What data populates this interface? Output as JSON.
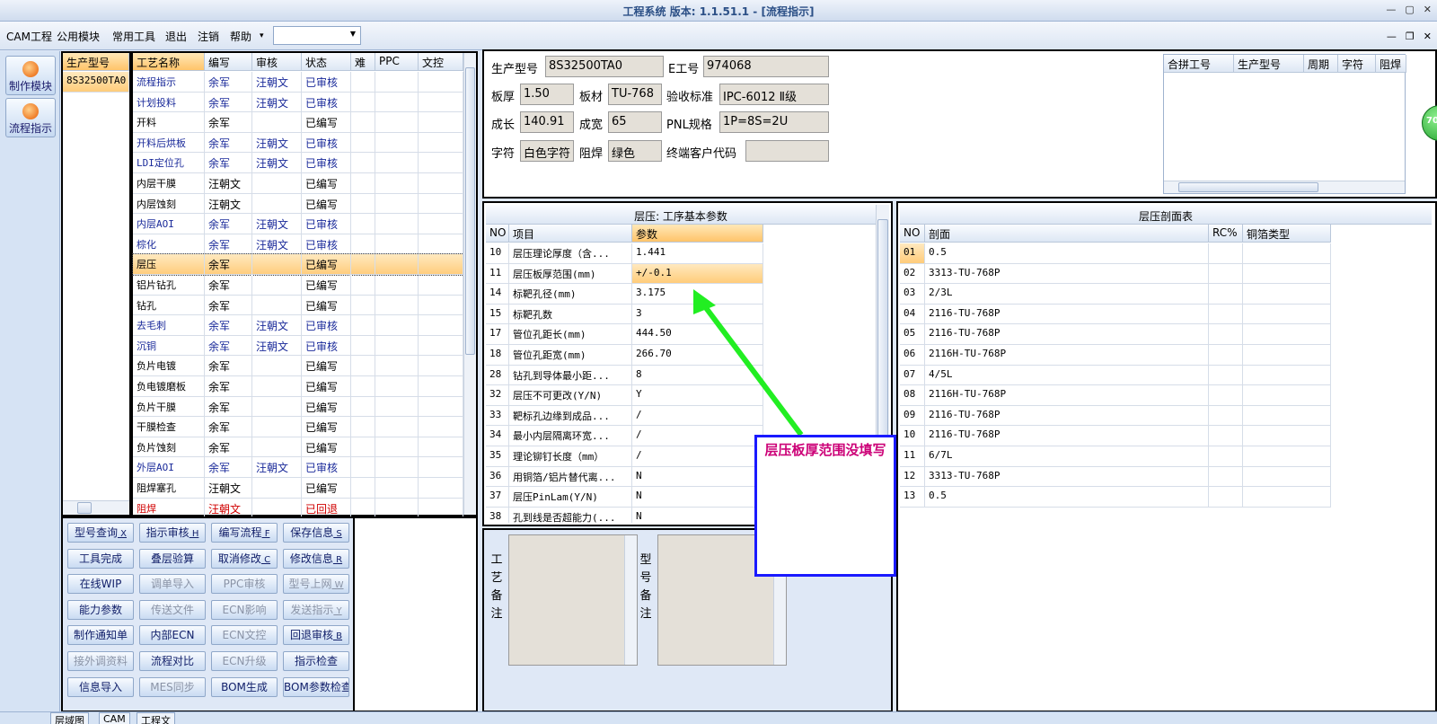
{
  "window": {
    "title": "工程系统   版本: 1.1.51.1 - [流程指示]"
  },
  "menu": [
    "CAM工程",
    "公用模块",
    "常用工具",
    "退出",
    "注销",
    "帮助"
  ],
  "menu_more": "▾",
  "sidebar": [
    {
      "label": "制作模块",
      "icon": "flame-icon"
    },
    {
      "label": "流程指示",
      "icon": "flow-icon"
    }
  ],
  "model_list": {
    "header": "生产型号",
    "items": [
      "8S32500TA0"
    ]
  },
  "process_table": {
    "columns": [
      "工艺名称",
      "编写",
      "审核",
      "状态",
      "难",
      "PPC",
      "文控"
    ],
    "rows": [
      {
        "name": "流程指示",
        "writer": "余军",
        "reviewer": "汪朝文",
        "status": "已审核",
        "color": "blue"
      },
      {
        "name": "计划投料",
        "writer": "余军",
        "reviewer": "汪朝文",
        "status": "已审核",
        "color": "blue"
      },
      {
        "name": "开料",
        "writer": "余军",
        "reviewer": "",
        "status": "已编写",
        "color": "black"
      },
      {
        "name": "开料后烘板",
        "writer": "余军",
        "reviewer": "汪朝文",
        "status": "已审核",
        "color": "blue"
      },
      {
        "name": "LDI定位孔",
        "writer": "余军",
        "reviewer": "汪朝文",
        "status": "已审核",
        "color": "blue"
      },
      {
        "name": "内层干膜",
        "writer": "汪朝文",
        "reviewer": "",
        "status": "已编写",
        "color": "black"
      },
      {
        "name": "内层蚀刻",
        "writer": "汪朝文",
        "reviewer": "",
        "status": "已编写",
        "color": "black"
      },
      {
        "name": "内层AOI",
        "writer": "余军",
        "reviewer": "汪朝文",
        "status": "已审核",
        "color": "blue"
      },
      {
        "name": "棕化",
        "writer": "余军",
        "reviewer": "汪朝文",
        "status": "已审核",
        "color": "blue"
      },
      {
        "name": "层压",
        "writer": "余军",
        "reviewer": "",
        "status": "已编写",
        "color": "black",
        "selected": true
      },
      {
        "name": "铝片钻孔",
        "writer": "余军",
        "reviewer": "",
        "status": "已编写",
        "color": "black"
      },
      {
        "name": "钻孔",
        "writer": "余军",
        "reviewer": "",
        "status": "已编写",
        "color": "black"
      },
      {
        "name": "去毛刺",
        "writer": "余军",
        "reviewer": "汪朝文",
        "status": "已审核",
        "color": "blue"
      },
      {
        "name": "沉铜",
        "writer": "余军",
        "reviewer": "汪朝文",
        "status": "已审核",
        "color": "blue"
      },
      {
        "name": "负片电镀",
        "writer": "余军",
        "reviewer": "",
        "status": "已编写",
        "color": "black"
      },
      {
        "name": "负电镀磨板",
        "writer": "余军",
        "reviewer": "",
        "status": "已编写",
        "color": "black"
      },
      {
        "name": "负片干膜",
        "writer": "余军",
        "reviewer": "",
        "status": "已编写",
        "color": "black"
      },
      {
        "name": "干膜检查",
        "writer": "余军",
        "reviewer": "",
        "status": "已编写",
        "color": "black"
      },
      {
        "name": "负片蚀刻",
        "writer": "余军",
        "reviewer": "",
        "status": "已编写",
        "color": "black"
      },
      {
        "name": "外层AOI",
        "writer": "余军",
        "reviewer": "汪朝文",
        "status": "已审核",
        "color": "blue"
      },
      {
        "name": "阻焊塞孔",
        "writer": "汪朝文",
        "reviewer": "",
        "status": "已编写",
        "color": "black"
      },
      {
        "name": "阻焊",
        "writer": "汪朝文",
        "reviewer": "",
        "status": "已回退",
        "color": "red"
      }
    ]
  },
  "action_buttons": [
    {
      "label": "型号查询",
      "key": "X",
      "enabled": true
    },
    {
      "label": "指示审核",
      "key": "H",
      "enabled": true
    },
    {
      "label": "编写流程",
      "key": "F",
      "enabled": true
    },
    {
      "label": "保存信息",
      "key": "S",
      "enabled": true
    },
    {
      "label": "工具完成",
      "key": "",
      "enabled": true
    },
    {
      "label": "叠层验算",
      "key": "",
      "enabled": true
    },
    {
      "label": "取消修改",
      "key": "C",
      "enabled": true
    },
    {
      "label": "修改信息",
      "key": "R",
      "enabled": true
    },
    {
      "label": "在线WIP",
      "key": "",
      "enabled": true
    },
    {
      "label": "调单导入",
      "key": "",
      "enabled": false
    },
    {
      "label": "PPC审核",
      "key": "",
      "enabled": false
    },
    {
      "label": "型号上网",
      "key": "W",
      "enabled": false
    },
    {
      "label": "能力参数",
      "key": "",
      "enabled": true
    },
    {
      "label": "传送文件",
      "key": "",
      "enabled": false
    },
    {
      "label": "ECN影响",
      "key": "",
      "enabled": false
    },
    {
      "label": "发送指示",
      "key": "Y",
      "enabled": false
    },
    {
      "label": "制作通知单",
      "key": "",
      "enabled": true
    },
    {
      "label": "内部ECN",
      "key": "",
      "enabled": true
    },
    {
      "label": "ECN文控",
      "key": "",
      "enabled": false
    },
    {
      "label": "回退审核",
      "key": "B",
      "enabled": true
    },
    {
      "label": "接外调资料",
      "key": "",
      "enabled": false
    },
    {
      "label": "流程对比",
      "key": "",
      "enabled": true
    },
    {
      "label": "ECN升级",
      "key": "",
      "enabled": false
    },
    {
      "label": "指示检查",
      "key": "",
      "enabled": true
    },
    {
      "label": "信息导入",
      "key": "",
      "enabled": true
    },
    {
      "label": "MES同步",
      "key": "",
      "enabled": false
    },
    {
      "label": "BOM生成",
      "key": "",
      "enabled": true
    },
    {
      "label": "BOM参数检查",
      "key": "",
      "enabled": true
    }
  ],
  "info": {
    "model_label": "生产型号",
    "model_value": "8S32500TA0",
    "eno_label": "E工号",
    "eno_value": "974068",
    "thickness_label": "板厚",
    "thickness_value": "1.50",
    "material_label": "板材",
    "material_value": "TU-768",
    "standard_label": "验收标准",
    "standard_value": "IPC-6012 Ⅱ级",
    "length_label": "成长",
    "length_value": "140.91",
    "width_label": "成宽",
    "width_value": "65",
    "pnl_label": "PNL规格",
    "pnl_value": "1P=8S=2U",
    "char_label": "字符",
    "char_value": "白色字符",
    "mask_label": "阻焊",
    "mask_value": "绿色",
    "customer_label": "终端客户代码",
    "customer_value": ""
  },
  "merge_table": {
    "columns": [
      "合拼工号",
      "生产型号",
      "周期",
      "字符",
      "阻焊"
    ]
  },
  "side_badge": "70",
  "param_table": {
    "title": "层压: 工序基本参数",
    "columns": [
      "NO",
      "项目",
      "参数"
    ],
    "rows": [
      [
        "10",
        "层压理论厚度（含...",
        "1.441"
      ],
      [
        "11",
        "层压板厚范围(mm)",
        "+/-0.1"
      ],
      [
        "14",
        "标靶孔径(mm)",
        "3.175"
      ],
      [
        "15",
        "标靶孔数",
        "3"
      ],
      [
        "17",
        "管位孔距长(mm)",
        "444.50"
      ],
      [
        "18",
        "管位孔距宽(mm)",
        "266.70"
      ],
      [
        "28",
        "钻孔到导体最小距...",
        "8"
      ],
      [
        "32",
        "层压不可更改(Y/N)",
        "Y"
      ],
      [
        "33",
        "靶标孔边缘到成品...",
        "/"
      ],
      [
        "34",
        "最小内层隔离环宽...",
        "/"
      ],
      [
        "35",
        "理论铆钉长度（mm）",
        "/"
      ],
      [
        "36",
        "用铜箔/铝片替代离...",
        "N"
      ],
      [
        "37",
        "层压PinLam(Y/N)",
        "N"
      ],
      [
        "38",
        "孔到线是否超能力(...",
        "N"
      ]
    ]
  },
  "stack_table": {
    "title": "层压剖面表",
    "columns": [
      "NO",
      "剖面",
      "RC%",
      "铜箔类型"
    ],
    "rows": [
      [
        "01",
        "0.5"
      ],
      [
        "02",
        "3313-TU-768P"
      ],
      [
        "03",
        "2/3L"
      ],
      [
        "04",
        "2116-TU-768P"
      ],
      [
        "05",
        "2116-TU-768P"
      ],
      [
        "06",
        "2116H-TU-768P"
      ],
      [
        "07",
        "4/5L"
      ],
      [
        "08",
        "2116H-TU-768P"
      ],
      [
        "09",
        "2116-TU-768P"
      ],
      [
        "10",
        "2116-TU-768P"
      ],
      [
        "11",
        "6/7L"
      ],
      [
        "12",
        "3313-TU-768P"
      ],
      [
        "13",
        "0.5"
      ]
    ]
  },
  "notes": {
    "process_note_label": "工艺备注",
    "model_note_label": "型号备注"
  },
  "annotation": {
    "text": "层压板厚范围没填写",
    "color": "#cc0077",
    "arrow_color": "#22ee22"
  },
  "bottom_tabs": [
    "层域图",
    "CAM",
    "工程文"
  ]
}
